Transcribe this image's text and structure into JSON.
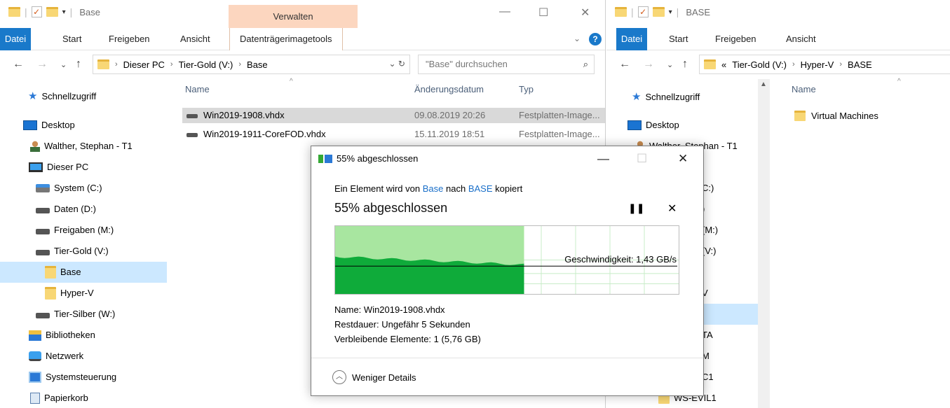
{
  "left_window": {
    "title": "Base",
    "contextual_tab": "Verwalten",
    "ribbon_tabs": [
      "Datei",
      "Start",
      "Freigeben",
      "Ansicht",
      "Datenträgerimagetools"
    ],
    "breadcrumb": [
      "Dieser PC",
      "Tier-Gold (V:)",
      "Base"
    ],
    "search_placeholder": "\"Base\" durchsuchen",
    "nav_items": [
      {
        "label": "Schnellzugriff",
        "icon": "star-icon"
      },
      {
        "label": "Desktop",
        "icon": "desktop-icon"
      },
      {
        "label": "Walther, Stephan - T1",
        "icon": "user-icon"
      },
      {
        "label": "Dieser PC",
        "icon": "computer-icon"
      },
      {
        "label": "System (C:)",
        "icon": "system-drive-icon"
      },
      {
        "label": "Daten (D:)",
        "icon": "drive-icon"
      },
      {
        "label": "Freigaben (M:)",
        "icon": "network-drive-icon"
      },
      {
        "label": "Tier-Gold (V:)",
        "icon": "drive-icon"
      },
      {
        "label": "Base",
        "icon": "folder-icon"
      },
      {
        "label": "Hyper-V",
        "icon": "folder-icon"
      },
      {
        "label": "Tier-Silber (W:)",
        "icon": "drive-icon"
      },
      {
        "label": "Bibliotheken",
        "icon": "library-icon"
      },
      {
        "label": "Netzwerk",
        "icon": "network-icon"
      },
      {
        "label": "Systemsteuerung",
        "icon": "control-panel-icon"
      },
      {
        "label": "Papierkorb",
        "icon": "recycle-bin-icon"
      }
    ],
    "selected_nav": "Base",
    "columns": [
      "Name",
      "Änderungsdatum",
      "Typ"
    ],
    "files": [
      {
        "name": "Win2019-1908.vhdx",
        "date": "09.08.2019 20:26",
        "type": "Festplatten-Image..."
      },
      {
        "name": "Win2019-1911-CoreFOD.vhdx",
        "date": "15.11.2019 18:51",
        "type": "Festplatten-Image..."
      }
    ]
  },
  "right_window": {
    "title": "BASE",
    "ribbon_tabs": [
      "Datei",
      "Start",
      "Freigeben",
      "Ansicht"
    ],
    "breadcrumb_prefix": "«",
    "breadcrumb": [
      "Tier-Gold (V:)",
      "Hyper-V",
      "BASE"
    ],
    "nav_items": [
      {
        "label": "Schnellzugriff"
      },
      {
        "label": "Desktop"
      },
      {
        "label": "Walther, Stephan - T1"
      }
    ],
    "partial_nav_texts": [
      "C:)",
      ")",
      "(M:)",
      "(V:)",
      "V",
      "TA",
      "M",
      "C1",
      "WS-EVIL1"
    ],
    "columns": [
      "Name"
    ],
    "files": [
      {
        "name": "Virtual Machines"
      }
    ]
  },
  "dialog": {
    "title": "55% abgeschlossen",
    "line_prefix": "Ein Element wird von",
    "source": "Base",
    "line_middle": "nach",
    "destination": "BASE",
    "line_suffix": "kopiert",
    "percent_text": "55% abgeschlossen",
    "progress_fraction": 0.55,
    "speed_label": "Geschwindigkeit: 1,43 GB/s",
    "name_label": "Name:",
    "name_value": "Win2019-1908.vhdx",
    "remaining_label": "Restdauer:",
    "remaining_value": "Ungefähr 5 Sekunden",
    "items_label": "Verbleibende Elemente:",
    "items_value": "1 (5,76 GB)",
    "less_details": "Weniger Details",
    "colors": {
      "progress_fill": "#a8e6a0",
      "speed_fill": "#0fab3a",
      "grid": "#c8ecc8"
    }
  }
}
